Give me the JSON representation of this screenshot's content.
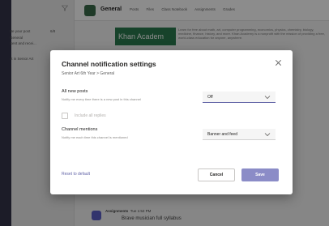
{
  "background": {
    "channel_pane": {
      "line1": "Be your post",
      "line2": "General",
      "line3": "Sent and recei...",
      "line4": "st in Senior Art",
      "date": "6/8"
    },
    "team_name": "General",
    "tabs": [
      "Posts",
      "Files",
      "Class Notebook",
      "Assignments",
      "Grades"
    ],
    "banner_text": "Khan Academ",
    "post_text": "Learn for free about math, art, computer programming, economics, physics, chemistry, biology, medicine, finance, history, and more. Khan Academy is a nonprofit with the mission of providing a free, world-class education for anyone, anywhere.",
    "side_post": "Academy",
    "bottom_post_name": "Assignments",
    "bottom_post_time": "Tue 1:52 PM",
    "bottom_post_title": "Brave musician full syllabus"
  },
  "dialog": {
    "title": "Channel notification settings",
    "subtitle": "Senior Art 6th Year > General",
    "new_posts": {
      "label": "All new posts",
      "description": "Notify me every time there is a new post in this channel",
      "value": "Off"
    },
    "include_replies": {
      "label": "Include all replies",
      "checked": false
    },
    "mentions": {
      "label": "Channel mentions",
      "description": "Notify me each time this channel is mentioned",
      "value": "Banner and feed"
    },
    "reset_label": "Reset to default",
    "cancel_label": "Cancel",
    "save_label": "Save"
  },
  "colors": {
    "accent": "#6264a7",
    "save_button": "#8b8cc7",
    "banner": "#2b7b4f"
  },
  "icons": {
    "close": "close-icon",
    "dropdown": "chevron-down-icon",
    "filter": "filter-icon"
  }
}
